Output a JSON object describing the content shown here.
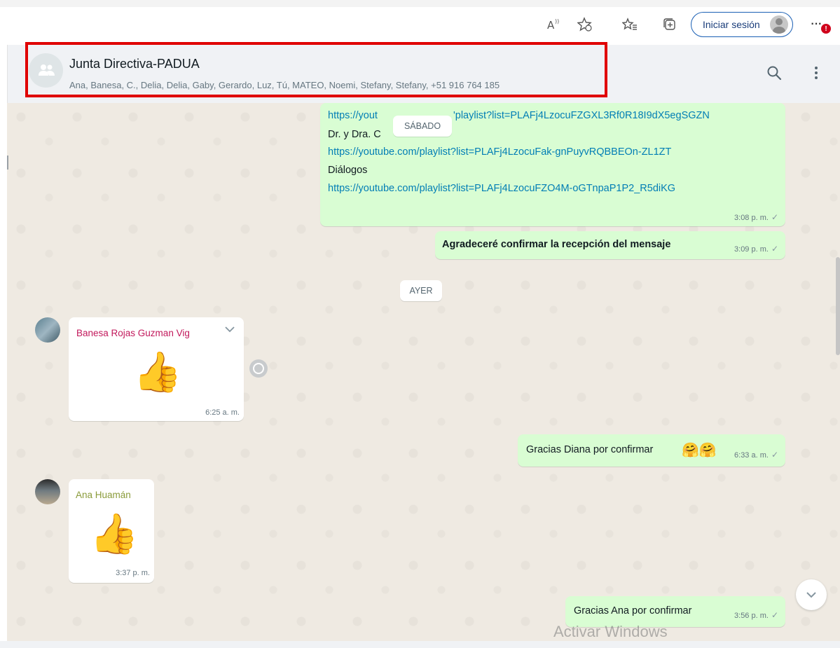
{
  "browser": {
    "read_aloud_icon": "read-aloud-icon",
    "favorites_add_icon": "add-favorite-icon",
    "favorites_icon": "favorites-icon",
    "collections_icon": "collections-icon",
    "signin_label": "Iniciar sesión",
    "more_icon": "more-icon",
    "notification_badge": "!"
  },
  "chat": {
    "title": "Junta Directiva-PADUA",
    "members": "Ana, Banesa, C., Delia, Delia, Gaby, Gerardo, Luz, Tú, MATEO, Noemi, Stefany, Stefany, +51 916 764 185",
    "highlight_color": "#e00000"
  },
  "messages": {
    "links_message": {
      "lines": [
        {
          "text": "https://yout",
          "type": "link"
        },
        {
          "text": "'playlist?list=PLAFj4LzocuFZGXL3Rf0R18I9dX5egSGZN",
          "type": "link"
        },
        {
          "text": "Dr. y Dra. C",
          "type": "text"
        },
        {
          "text": "https://youtube.com/playlist?list=PLAFj4LzocuFak-gnPuyvRQBBEOn-ZL1ZT",
          "type": "link"
        },
        {
          "text": "Diálogos",
          "type": "text"
        },
        {
          "text": "https://youtube.com/playlist?list=PLAFj4LzocuFZO4M-oGTnpaP1P2_R5diKG",
          "type": "link"
        }
      ],
      "time": "3:08 p. m."
    },
    "sabado_pill": "SÁBADO",
    "confirm_request": {
      "text": "Agradeceré confirmar la recepción del mensaje",
      "time": "3:09 p. m."
    },
    "ayer_pill": "AYER",
    "banesa_message": {
      "sender": "Banesa Rojas Guzman Vig",
      "emoji": "👍",
      "time": "6:25 a. m.",
      "sender_color": "#c2185b"
    },
    "thanks_diana": {
      "text": "Gracias Diana por confirmar",
      "emoji": "🤗🤗",
      "time": "6:33 a. m."
    },
    "ana_message": {
      "sender": "Ana Huamán",
      "emoji": "👍",
      "time": "3:37 p. m.",
      "sender_color": "#8a9b3a"
    },
    "thanks_ana": {
      "text": "Gracias Ana por confirmar",
      "time": "3:56 p. m."
    },
    "check": "✓"
  },
  "overlay": {
    "watermark": "Activar Windows"
  },
  "colors": {
    "outgoing_bubble": "#d9fdd3",
    "incoming_bubble": "#ffffff",
    "chat_background": "#efeae2",
    "link": "#027eb5"
  }
}
